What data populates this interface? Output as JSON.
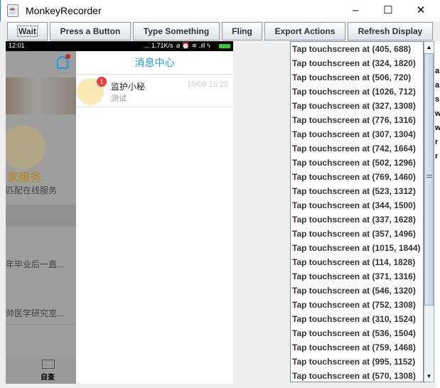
{
  "window": {
    "title": "MonkeyRecorder",
    "icon": "java-icon",
    "minimize": "–",
    "maximize": "☐",
    "close": "✕"
  },
  "toolbar": {
    "buttons": [
      "Wait",
      "Press a Button",
      "Type Something",
      "Fling",
      "Export Actions",
      "Refresh Display"
    ]
  },
  "phone": {
    "status": {
      "time": "12:01",
      "speed": "... 1.71K/s",
      "icons": "⌀ ⏰ ≋ .ıll ϟ"
    },
    "header_title": "消息中心",
    "message": {
      "sender": "监护小秘",
      "time": "10/08 15:22",
      "preview": "测试",
      "badge": "1"
    },
    "bg": {
      "expert_title": "家服务",
      "expert_sub": "匹配在线服务",
      "item1": "年毕业后一直...",
      "item2": "帅医学研究室...",
      "tab": "自查"
    }
  },
  "actions": [
    "Tap touchscreen at (405, 688)",
    "Tap touchscreen at (324, 1820)",
    "Tap touchscreen at (506, 720)",
    "Tap touchscreen at (1026, 712)",
    "Tap touchscreen at (327, 1308)",
    "Tap touchscreen at (776, 1316)",
    "Tap touchscreen at (307, 1304)",
    "Tap touchscreen at (742, 1664)",
    "Tap touchscreen at (502, 1296)",
    "Tap touchscreen at (769, 1460)",
    "Tap touchscreen at (523, 1312)",
    "Tap touchscreen at (344, 1500)",
    "Tap touchscreen at (337, 1628)",
    "Tap touchscreen at (357, 1496)",
    "Tap touchscreen at (1015, 1844)",
    "Tap touchscreen at (114, 1828)",
    "Tap touchscreen at (371, 1316)",
    "Tap touchscreen at (546, 1320)",
    "Tap touchscreen at (752, 1308)",
    "Tap touchscreen at (310, 1524)",
    "Tap touchscreen at (536, 1504)",
    "Tap touchscreen at (759, 1468)",
    "Tap touchscreen at (995, 1152)",
    "Tap touchscreen at (570, 1308)"
  ],
  "background_chars": [
    "a",
    "a",
    "s",
    "w",
    "w",
    "r",
    "r"
  ],
  "colors": {
    "accent": "#1e9be8",
    "gold": "#b8860b",
    "badge": "#f03c3c"
  }
}
